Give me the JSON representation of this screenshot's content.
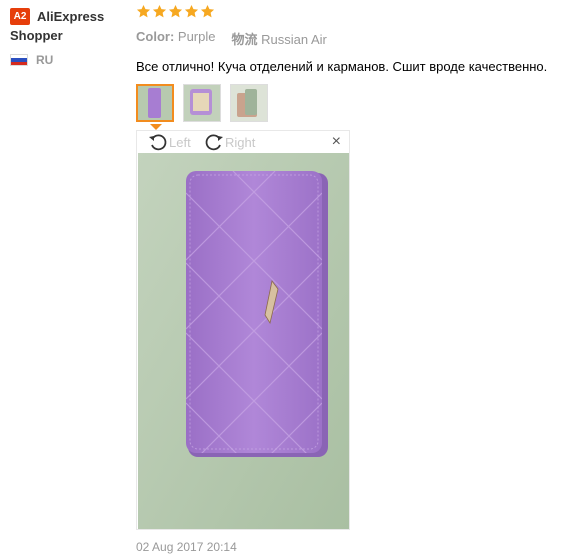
{
  "user": {
    "avatar_text": "A2",
    "name": "AliExpress Shopper",
    "country_code": "RU",
    "flag_icon": "russia-flag-icon"
  },
  "review": {
    "rating": 5,
    "rating_max": 5,
    "star_color": "#f6a821",
    "color_label": "Color:",
    "color_value": "Purple",
    "shipping_label": "物流",
    "shipping_value": "Russian Air",
    "text": "Все отлично! Куча отделений и карманов. Сшит вроде качественно.",
    "date": "02 Aug 2017 20:14"
  },
  "viewer": {
    "rotate_left_label": "Left",
    "rotate_right_label": "Right",
    "close_symbol": "×"
  },
  "thumbnails": [
    {
      "name": "thumbnail-1",
      "active": true
    },
    {
      "name": "thumbnail-2",
      "active": false
    },
    {
      "name": "thumbnail-3",
      "active": false
    }
  ],
  "colors": {
    "accent_orange": "#f28c1e",
    "avatar_red": "#e63e0b",
    "wallet_purple": "#a77dd2",
    "background_green": "#b9cdb1"
  }
}
